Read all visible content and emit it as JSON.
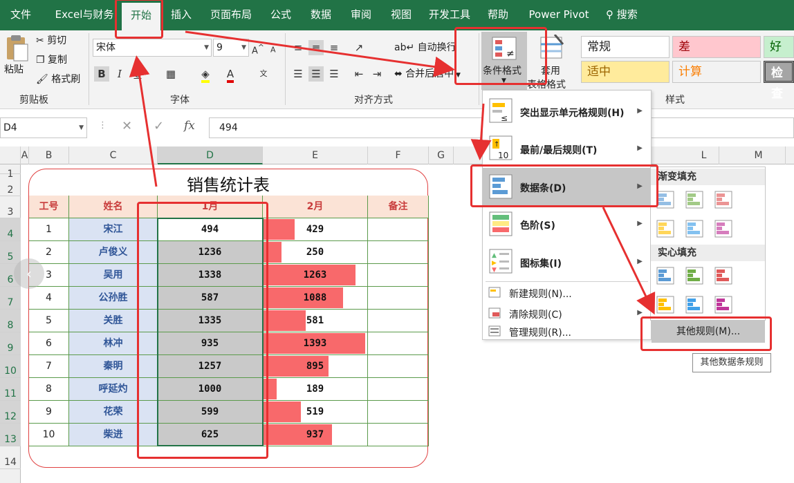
{
  "tabs": [
    "文件",
    "Excel与财务",
    "开始",
    "插入",
    "页面布局",
    "公式",
    "数据",
    "审阅",
    "视图",
    "开发工具",
    "帮助",
    "Power Pivot"
  ],
  "search_label": "搜索",
  "ribbon": {
    "paste": "粘贴",
    "cut": "剪切",
    "copy": "复制",
    "format_painter": "格式刷",
    "clipboard_group": "剪贴板",
    "font_name": "宋体",
    "font_size": "9",
    "bold": "B",
    "italic": "I",
    "font_group": "字体",
    "wrap_text": "自动换行",
    "merge_center": "合并后居中",
    "align_group": "对齐方式",
    "cond_format": "条件格式",
    "table_format_1": "套用",
    "table_format_2": "表格格式",
    "styles_group": "样式",
    "styles": [
      {
        "label": "常规",
        "bg": "#ffffff",
        "color": "#222222"
      },
      {
        "label": "差",
        "bg": "#ffc7ce",
        "color": "#9c0006"
      },
      {
        "label": "好",
        "bg": "#c6efce",
        "color": "#006100"
      },
      {
        "label": "适中",
        "bg": "#ffeb9c",
        "color": "#9c6500"
      },
      {
        "label": "计算",
        "bg": "#f2f2f2",
        "color": "#fa7d00"
      },
      {
        "label": "检查",
        "bg": "#a5a5a5",
        "color": "#ffffff"
      }
    ]
  },
  "namebox": "D4",
  "formula_value": "494",
  "columns": [
    "A",
    "B",
    "C",
    "D",
    "E",
    "F",
    "G",
    "L",
    "M"
  ],
  "rows": [
    "1",
    "2",
    "3",
    "4",
    "5",
    "6",
    "7",
    "8",
    "9",
    "10",
    "11",
    "12",
    "13",
    "14"
  ],
  "sheet": {
    "title": "销售统计表",
    "headers": [
      "工号",
      "姓名",
      "1月",
      "2月",
      "备注"
    ],
    "rows": [
      {
        "id": "1",
        "name": "宋江",
        "m1": 494,
        "m2": 429
      },
      {
        "id": "2",
        "name": "卢俊义",
        "m1": 1236,
        "m2": 250
      },
      {
        "id": "3",
        "name": "吴用",
        "m1": 1338,
        "m2": 1263
      },
      {
        "id": "4",
        "name": "公孙胜",
        "m1": 587,
        "m2": 1088
      },
      {
        "id": "5",
        "name": "关胜",
        "m1": 1335,
        "m2": 581
      },
      {
        "id": "6",
        "name": "林冲",
        "m1": 935,
        "m2": 1393
      },
      {
        "id": "7",
        "name": "秦明",
        "m1": 1257,
        "m2": 895
      },
      {
        "id": "8",
        "name": "呼延灼",
        "m1": 1000,
        "m2": 189
      },
      {
        "id": "9",
        "name": "花荣",
        "m1": 599,
        "m2": 519
      },
      {
        "id": "10",
        "name": "柴进",
        "m1": 625,
        "m2": 937
      }
    ],
    "bar_color": "#f8696b"
  },
  "cf_menu": {
    "items": [
      "突出显示单元格规则(H)",
      "最前/最后规则(T)",
      "数据条(D)",
      "色阶(S)",
      "图标集(I)"
    ],
    "small_items": [
      "新建规则(N)...",
      "清除规则(C)",
      "管理规则(R)..."
    ]
  },
  "databar_submenu": {
    "gradient": "渐变填充",
    "solid": "实心填充",
    "other_rules": "其他规则(M)...",
    "tooltip": "其他数据条规则",
    "colors": [
      "#5b9bd5",
      "#70ad47",
      "#e05a5a",
      "#ffc000",
      "#41a0e8",
      "#c0379a"
    ]
  }
}
